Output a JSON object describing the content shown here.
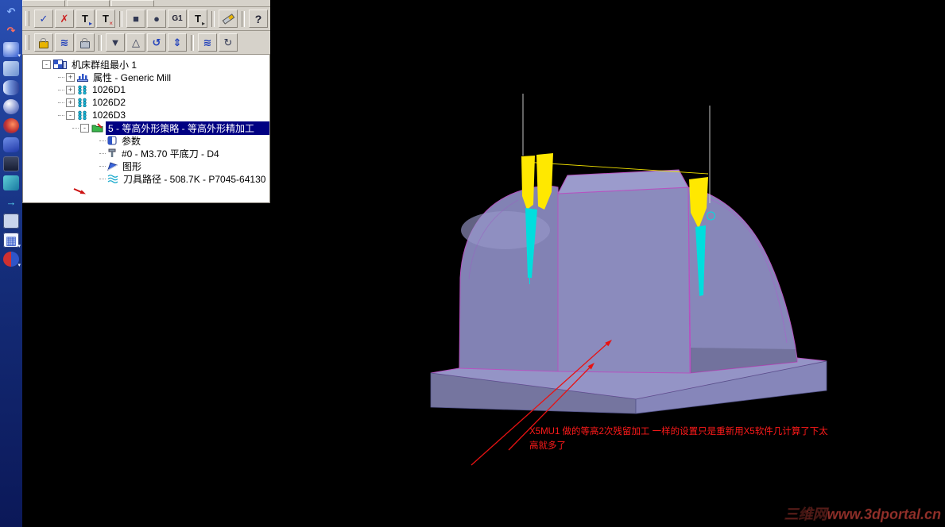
{
  "left_rail": {
    "icons": [
      {
        "name": "undo-icon",
        "glyph": "↶"
      },
      {
        "name": "redo-icon",
        "glyph": "↷"
      },
      {
        "name": "shaded-sphere-icon"
      },
      {
        "name": "plane-icon"
      },
      {
        "name": "cylinder-icon"
      },
      {
        "name": "sphere-icon"
      },
      {
        "name": "torus-icon"
      },
      {
        "name": "solid-icon"
      },
      {
        "name": "dark-panel-icon"
      },
      {
        "name": "cube-icon"
      },
      {
        "name": "flow-arrow-icon",
        "glyph": "→"
      },
      {
        "name": "panel-icon"
      },
      {
        "name": "grid-icon",
        "glyph": "▦"
      },
      {
        "name": "half-pie-icon"
      }
    ]
  },
  "toolbars": {
    "row1": {
      "buttons": [
        {
          "name": "verify-select-button",
          "glyph": "✓"
        },
        {
          "name": "verify-clear-button",
          "glyph": "✗"
        },
        {
          "name": "select-toolpath-button",
          "glyph": "T",
          "accent": "▸"
        },
        {
          "name": "deselect-toolpath-button",
          "glyph": "T",
          "accent": "×"
        },
        {
          "name": "stock-display-button",
          "glyph": "■"
        },
        {
          "name": "shaded-display-button",
          "glyph": "●"
        },
        {
          "name": "g1-filter-button",
          "glyph": "G1"
        },
        {
          "name": "toolpath-arrow-button",
          "glyph": "T",
          "accent": "▸"
        },
        {
          "name": "trim-knife-button"
        },
        {
          "name": "help-button",
          "glyph": "?"
        }
      ]
    },
    "row2": {
      "buttons": [
        {
          "name": "lock-button"
        },
        {
          "name": "toolpath-waves-button",
          "glyph": "≋"
        },
        {
          "name": "lock-alt-button"
        },
        {
          "name": "dropdown-button",
          "glyph": "▼"
        },
        {
          "name": "triangle-button",
          "glyph": "△"
        },
        {
          "name": "regenerate-button",
          "glyph": "↺"
        },
        {
          "name": "reorder-button",
          "glyph": "⇕"
        },
        {
          "name": "waves-button",
          "glyph": "≋"
        },
        {
          "name": "orbit-button",
          "glyph": "↻"
        }
      ]
    }
  },
  "tree": {
    "items": [
      {
        "label": "机床群组最小 1",
        "expand": "-"
      },
      {
        "label": "属性 - Generic Mill",
        "expand": "+"
      },
      {
        "label": "1026D1",
        "expand": "+"
      },
      {
        "label": "1026D2",
        "expand": "+"
      },
      {
        "label": "1026D3",
        "expand": "-"
      },
      {
        "label": "5 - 等高外形策略 - 等高外形精加工",
        "expand": "-",
        "selected": true
      },
      {
        "label": "参数"
      },
      {
        "label": "#0 - M3.70 平底刀 - D4"
      },
      {
        "label": "图形"
      },
      {
        "label": "刀具路径 - 508.7K - P7045-64130"
      }
    ]
  },
  "viewport": {
    "annotation": {
      "line1": "X5MU1 做的等高2次残留加工 一样的设置只是重新用X5软件几计算了下太",
      "line2": "高就多了"
    },
    "watermark": "三维网www.3dportal.cn",
    "colors": {
      "background": "#000000",
      "body": "#8e8ec2",
      "edge_highlight": "#b653c0",
      "toolpath_shank": "#ffe800",
      "toolpath_tip": "#00dede",
      "annotation": "#ff1a1a",
      "watermark": "#93302a",
      "selection_background": "#000082"
    }
  }
}
